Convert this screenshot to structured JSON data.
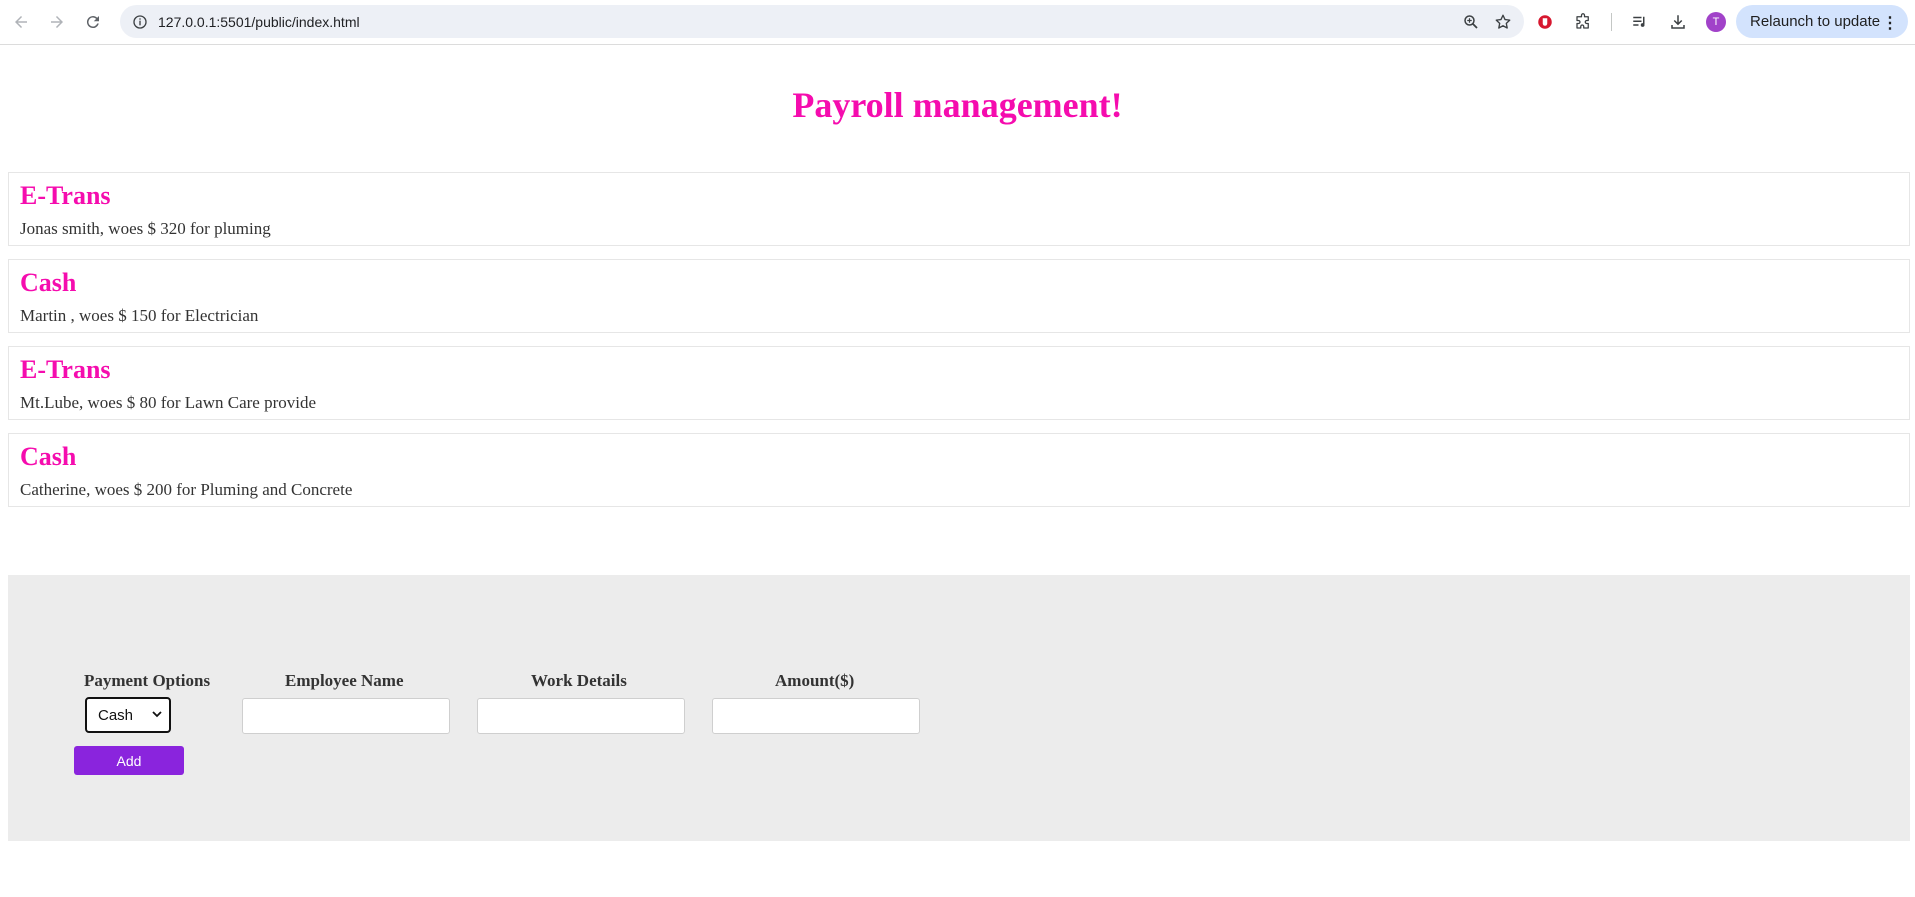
{
  "browser": {
    "url": "127.0.0.1:5501/public/index.html",
    "relaunch_label": "Relaunch to update",
    "avatar_letter": "T"
  },
  "page": {
    "title": "Payroll management!"
  },
  "payments": [
    {
      "method": "E-Trans",
      "description": "Jonas smith, woes $ 320 for pluming"
    },
    {
      "method": "Cash",
      "description": "Martin , woes $ 150 for Electrician"
    },
    {
      "method": "E-Trans",
      "description": "Mt.Lube, woes $ 80 for Lawn Care provide"
    },
    {
      "method": "Cash",
      "description": "Catherine, woes $ 200 for Pluming and Concrete"
    }
  ],
  "form": {
    "payment_options_label": "Payment Options",
    "payment_selected": "Cash",
    "employee_name_label": "Employee Name",
    "employee_name_value": "",
    "work_details_label": "Work Details",
    "work_details_value": "",
    "amount_label": "Amount($)",
    "amount_value": "",
    "add_label": "Add"
  },
  "colors": {
    "accent": "#f50cae",
    "button": "#8a24dd",
    "panel": "#ececec"
  }
}
